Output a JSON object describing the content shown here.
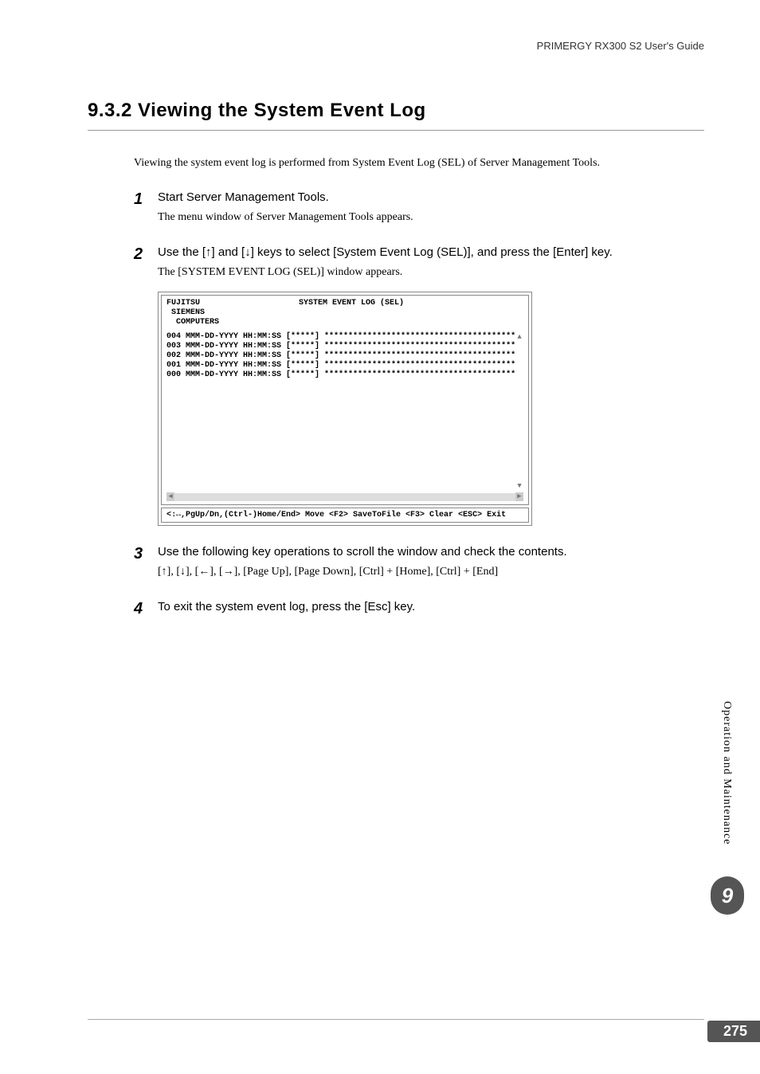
{
  "header": "PRIMERGY RX300 S2 User's Guide",
  "section_title": "9.3.2  Viewing the System Event Log",
  "intro": "Viewing the system event log is performed from System Event Log (SEL) of Server Management Tools.",
  "steps": [
    {
      "num": "1",
      "title": "Start Server Management Tools.",
      "desc": "The menu window of Server Management Tools appears."
    },
    {
      "num": "2",
      "title": "Use the [↑] and [↓] keys to select [System Event Log (SEL)], and press the [Enter] key.",
      "desc": "The [SYSTEM EVENT LOG (SEL)] window appears."
    },
    {
      "num": "3",
      "title": "Use the following key operations to scroll the window and check the contents.",
      "desc": "[↑], [↓], [←], [→], [Page Up], [Page Down], [Ctrl] + [Home], [Ctrl] + [End]"
    },
    {
      "num": "4",
      "title": "To exit the system event log, press the [Esc] key.",
      "desc": ""
    }
  ],
  "sel": {
    "vendor": "FUJITSU\n SIEMENS\n  COMPUTERS",
    "title": "SYSTEM EVENT LOG (SEL)",
    "rows": [
      "004 MMM-DD-YYYY HH:MM:SS [*****] ****************************************",
      "003 MMM-DD-YYYY HH:MM:SS [*****] ****************************************",
      "002 MMM-DD-YYYY HH:MM:SS [*****] ****************************************",
      "001 MMM-DD-YYYY HH:MM:SS [*****] ****************************************",
      "000 MMM-DD-YYYY HH:MM:SS [*****] ****************************************"
    ],
    "footer": "<↕↔,PgUp/Dn,(Ctrl-)Home/End> Move  <F2> SaveToFile  <F3> Clear  <ESC> Exit"
  },
  "side_label": "Operation and Maintenance",
  "chapter": "9",
  "page_number": "275"
}
